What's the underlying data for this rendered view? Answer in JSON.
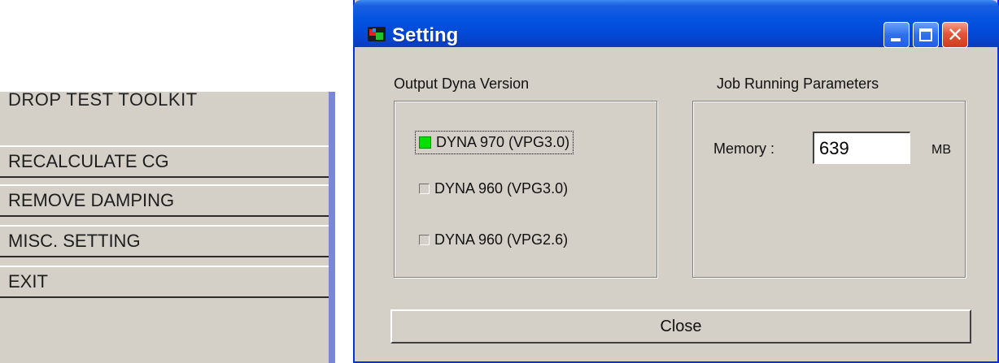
{
  "toolkit": {
    "title": "DROP TEST TOOLKIT",
    "items": [
      {
        "label": "RECALCULATE CG"
      },
      {
        "label": "REMOVE DAMPING"
      },
      {
        "label": "MISC. SETTING"
      },
      {
        "label": "EXIT"
      }
    ]
  },
  "window": {
    "title": "Setting",
    "output_group": {
      "title": "Output Dyna Version",
      "options": [
        {
          "label": "DYNA 970 (VPG3.0)",
          "checked": true
        },
        {
          "label": "DYNA 960 (VPG3.0)",
          "checked": false
        },
        {
          "label": "DYNA 960 (VPG2.6)",
          "checked": false
        }
      ]
    },
    "job_group": {
      "title": "Job Running Parameters",
      "memory_label": "Memory :",
      "memory_value": "639",
      "memory_unit": "MB"
    },
    "close_label": "Close"
  },
  "colors": {
    "face": "#d4d0c8",
    "titlebar": "#0454e3",
    "accent_stripe": "#7a86d8",
    "checked": "#00e000"
  },
  "icons": [
    "app-icon",
    "minimize-icon",
    "maximize-icon",
    "close-icon"
  ]
}
